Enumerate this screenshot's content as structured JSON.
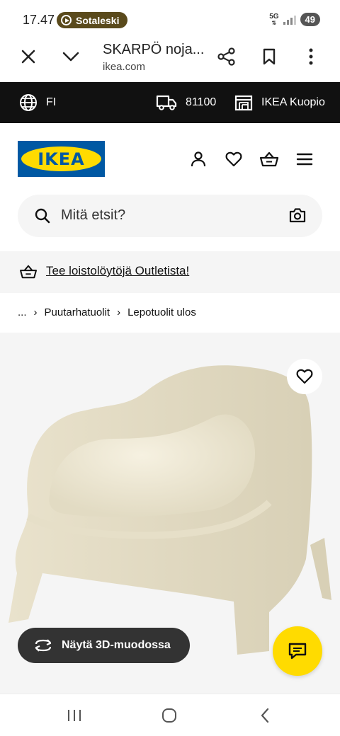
{
  "status_bar": {
    "time": "17.47",
    "media_pill": "Sotaleski",
    "network": "5G",
    "battery": "49"
  },
  "browser": {
    "title": "SKARPÖ noja...",
    "url": "ikea.com"
  },
  "top_bar": {
    "language": "FI",
    "postal_code": "81100",
    "store": "IKEA Kuopio"
  },
  "header": {
    "logo_text": "IKEA"
  },
  "search": {
    "placeholder": "Mitä etsit?"
  },
  "promo": {
    "text": "Tee loistolöytöjä Outletista!"
  },
  "breadcrumb": {
    "ellipsis": "...",
    "items": [
      "Puutarhatuolit",
      "Lepotuolit ulos"
    ]
  },
  "product": {
    "view_3d_label": "Näytä 3D-muodossa"
  },
  "colors": {
    "ikea_blue": "#0058a3",
    "ikea_yellow": "#ffdb00",
    "chair": "#ede7d3"
  }
}
